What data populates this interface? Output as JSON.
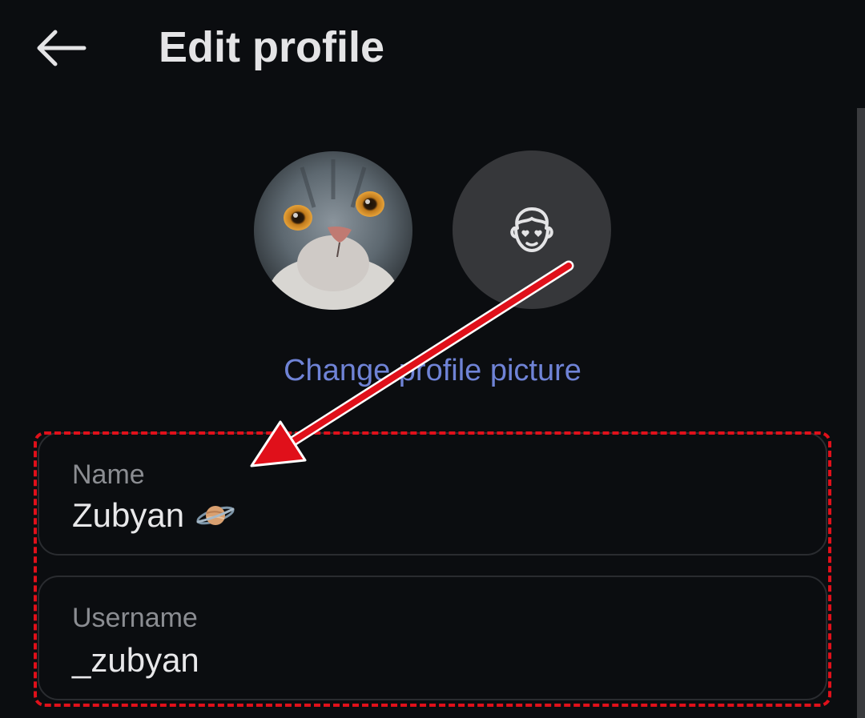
{
  "header": {
    "title": "Edit profile",
    "back_icon": "arrow-left-icon"
  },
  "profile_picture": {
    "avatar_icon": "cat-photo-avatar",
    "alt_avatar_icon": "face-heart-eyes-icon",
    "change_label": "Change profile picture"
  },
  "fields": {
    "name": {
      "label": "Name",
      "value": "Zubyan",
      "emoji_icon": "ringed-planet-icon"
    },
    "username": {
      "label": "Username",
      "value": "_zubyan"
    }
  },
  "annotation": {
    "arrow_color": "#e0101a",
    "highlight_color": "#e0101a"
  },
  "colors": {
    "background": "#0b0d10",
    "link": "#6f83d6",
    "text": "#e4e4e6",
    "label": "#8b8d92"
  }
}
